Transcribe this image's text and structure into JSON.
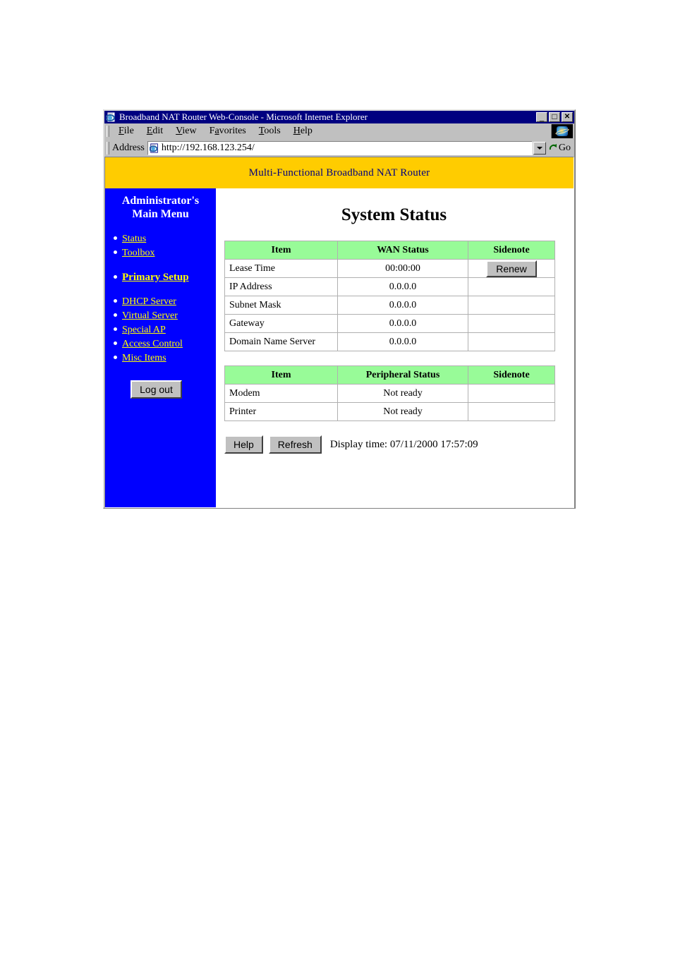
{
  "window": {
    "title": "Broadband NAT Router Web-Console - Microsoft Internet Explorer",
    "title_icon": "page-icon",
    "minimize_label": "_",
    "maximize_label": "□",
    "close_label": "✕"
  },
  "menubar": {
    "items": [
      {
        "pre": "",
        "accel": "F",
        "post": "ile"
      },
      {
        "pre": "",
        "accel": "E",
        "post": "dit"
      },
      {
        "pre": "",
        "accel": "V",
        "post": "iew"
      },
      {
        "pre": "F",
        "accel": "a",
        "post": "vorites"
      },
      {
        "pre": "",
        "accel": "T",
        "post": "ools"
      },
      {
        "pre": "",
        "accel": "H",
        "post": "elp"
      }
    ],
    "logo": "ie-logo"
  },
  "addressbar": {
    "label": "Address",
    "url": "http://192.168.123.254/",
    "go_label": "Go"
  },
  "banner": {
    "text": "Multi-Functional Broadband NAT Router",
    "bg_color": "#FFCC00",
    "text_color": "#000080"
  },
  "sidebar": {
    "title_line1": "Administrator's",
    "title_line2": "Main Menu",
    "bg_color": "#0000FF",
    "link_color": "#FFFF00",
    "items": [
      {
        "label": "Status",
        "current": false
      },
      {
        "label": "Toolbox",
        "current": false
      },
      {
        "label": "Primary Setup",
        "current": true
      },
      {
        "label": "DHCP Server",
        "current": false
      },
      {
        "label": "Virtual Server",
        "current": false
      },
      {
        "label": "Special AP",
        "current": false
      },
      {
        "label": "Access Control",
        "current": false
      },
      {
        "label": "Misc Items",
        "current": false
      }
    ],
    "logout_label": "Log out"
  },
  "main": {
    "title": "System Status",
    "wan_table": {
      "headers": [
        "Item",
        "WAN Status",
        "Sidenote"
      ],
      "header_bg": "#98FB98",
      "rows": [
        {
          "item": "Lease Time",
          "value": "00:00:00",
          "sidenote": "Renew"
        },
        {
          "item": "IP Address",
          "value": "0.0.0.0",
          "sidenote": ""
        },
        {
          "item": "Subnet Mask",
          "value": "0.0.0.0",
          "sidenote": ""
        },
        {
          "item": "Gateway",
          "value": "0.0.0.0",
          "sidenote": ""
        },
        {
          "item": "Domain Name Server",
          "value": "0.0.0.0",
          "sidenote": ""
        }
      ]
    },
    "peripheral_table": {
      "headers": [
        "Item",
        "Peripheral Status",
        "Sidenote"
      ],
      "header_bg": "#98FB98",
      "rows": [
        {
          "item": "Modem",
          "value": "Not ready",
          "sidenote": ""
        },
        {
          "item": "Printer",
          "value": "Not ready",
          "sidenote": ""
        }
      ]
    },
    "footer": {
      "help_label": "Help",
      "refresh_label": "Refresh",
      "display_time": "Display time: 07/11/2000 17:57:09"
    }
  }
}
